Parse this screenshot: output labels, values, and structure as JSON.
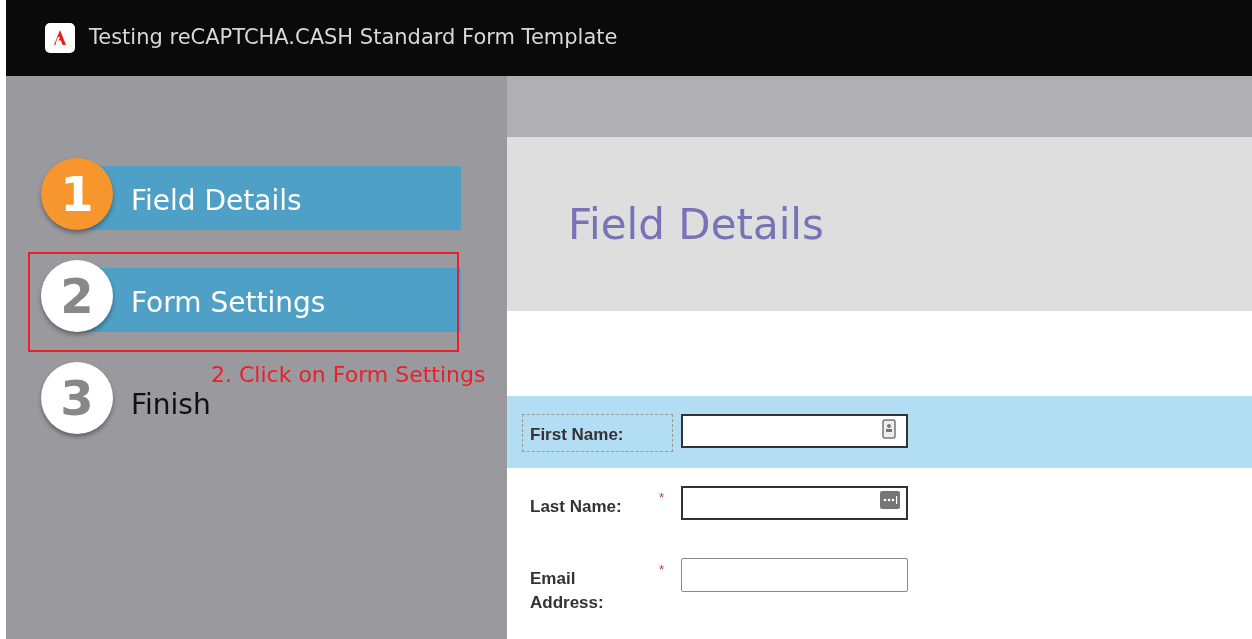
{
  "window": {
    "title": "Testing reCAPTCHA.CASH Standard Form Template"
  },
  "steps": [
    {
      "number": "1",
      "label": "Field Details",
      "current": true,
      "highlighted": true
    },
    {
      "number": "2",
      "label": "Form Settings",
      "current": false,
      "highlighted": true,
      "annotated": true
    },
    {
      "number": "3",
      "label": "Finish",
      "current": false,
      "highlighted": false
    }
  ],
  "annotation": {
    "text": "2. Click on Form Settings"
  },
  "page": {
    "heading": "Field Details"
  },
  "fields": [
    {
      "label": "First Name:",
      "required": false,
      "selected": true,
      "kind": "contact"
    },
    {
      "label": "Last Name:",
      "required": true,
      "selected": false,
      "kind": "password"
    },
    {
      "label": "Email Address:",
      "required": true,
      "selected": false,
      "kind": "plain"
    }
  ],
  "required_mark": "*"
}
